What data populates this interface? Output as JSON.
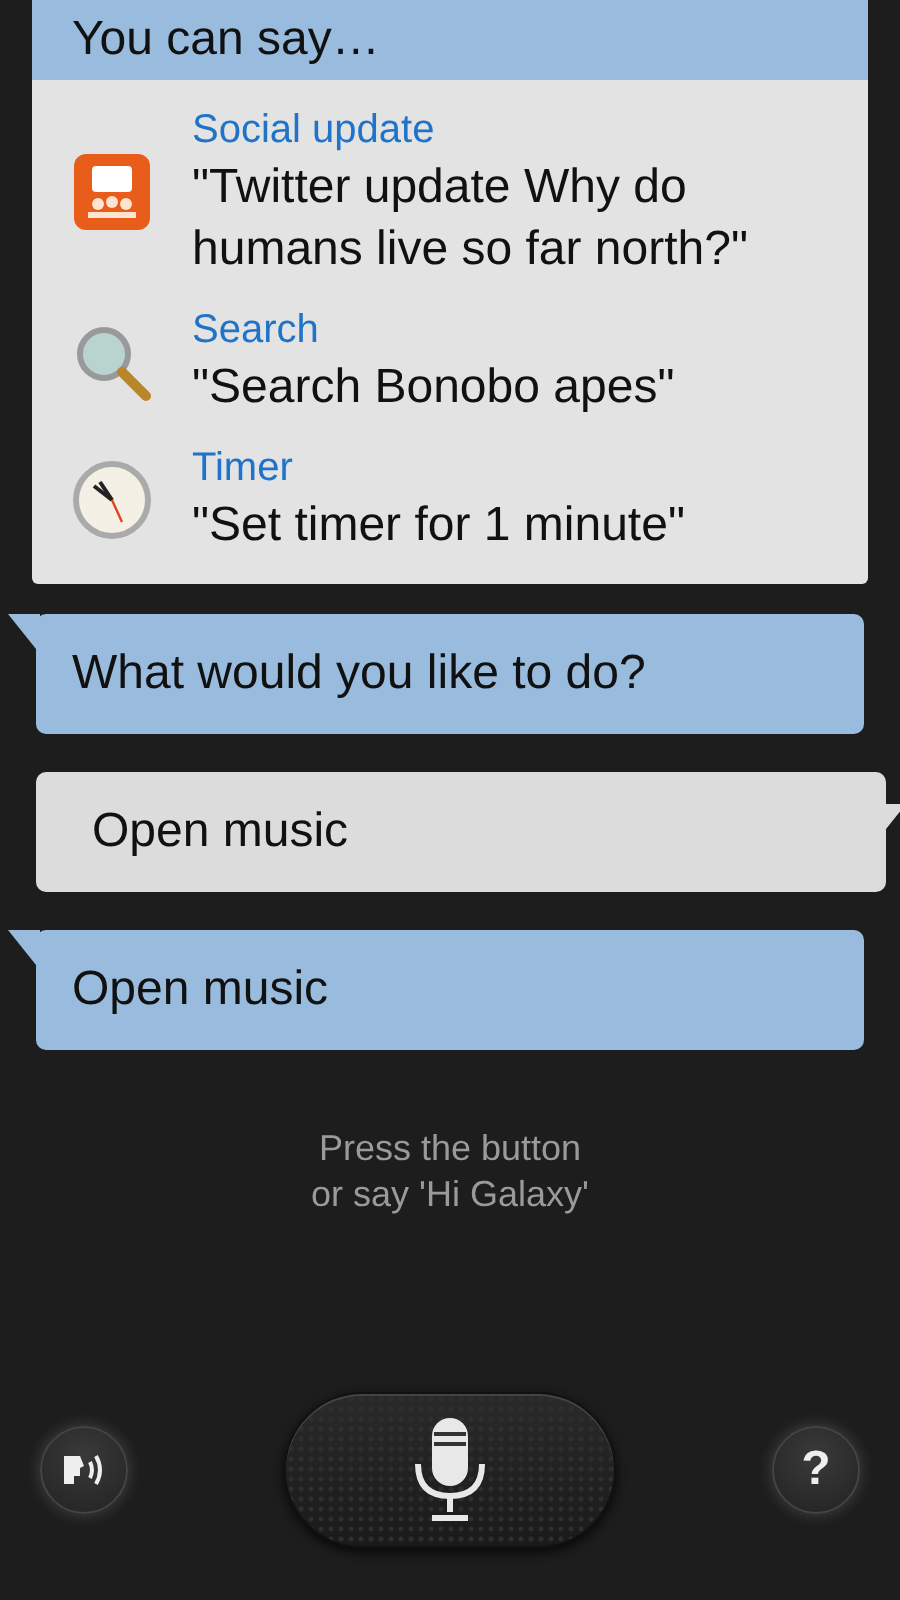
{
  "suggestions": {
    "title": "You can say…",
    "items": [
      {
        "kind": "social",
        "category": "Social update",
        "example": "\"Twitter update Why do humans live so far north?\""
      },
      {
        "kind": "search",
        "category": "Search",
        "example": "\"Search Bonobo apes\""
      },
      {
        "kind": "timer",
        "category": "Timer",
        "example": "\"Set timer for 1 minute\""
      }
    ]
  },
  "messages": [
    {
      "kind": "assistant",
      "text": "What would you like to do?"
    },
    {
      "kind": "user",
      "text": "Open music"
    },
    {
      "kind": "assistant",
      "text": "Open music"
    }
  ],
  "hint": [
    "Press the button",
    "or say 'Hi Galaxy'"
  ],
  "help_button": "?"
}
